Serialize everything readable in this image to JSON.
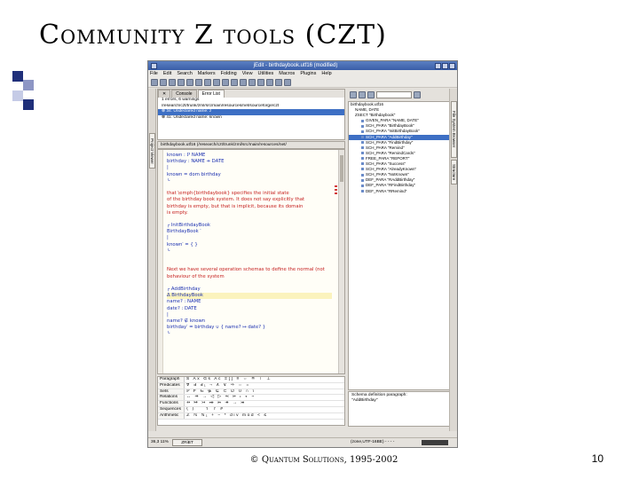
{
  "slide": {
    "title": "Community Z tools (CZT)",
    "footer": "© Quantum Solutions, 1995-2002",
    "page_number": "10",
    "bullet_colors": [
      "#1f2f7a",
      "#8d96c4",
      "#c5cbe6"
    ]
  },
  "window": {
    "title": "jEdit - birthdaybook.utf16 (modified)",
    "menu": [
      "File",
      "Edit",
      "Search",
      "Markers",
      "Folding",
      "View",
      "Utilities",
      "Macros",
      "Plugins",
      "Help"
    ]
  },
  "dock": {
    "left_tab": "Project Viewer",
    "right_tabs": [
      "File System Browser",
      "Structure"
    ]
  },
  "errors": {
    "tabs": [
      "Console",
      "Error List"
    ],
    "summary": "1 errors, 6 warnings",
    "lines": [
      "/research/czt/trunk/zml/src/main/resources/net/sourceforge/czt",
      "⊗ 34: Undeclared name: z",
      "⊗ 41: Undeclared name: known"
    ]
  },
  "buffer": {
    "name": "birthdaybook.utf16 (/research/czt/trunk/zml/src/main/resources/net/"
  },
  "editor": {
    "lines": [
      {
        "text": "known : ℙ NAME",
        "cls": "z"
      },
      {
        "text": "birthday : NAME ⇸ DATE",
        "cls": "z"
      },
      {
        "text": "|",
        "cls": "z"
      },
      {
        "text": "known = dom birthday",
        "cls": "z"
      },
      {
        "text": "└",
        "cls": "z"
      },
      {
        "text": "",
        "cls": "blank"
      },
      {
        "text": "that \\emph{birthdaybook} specifies the initial state",
        "cls": "red"
      },
      {
        "text": "of the birthday book system. It does not say explicitly that",
        "cls": "red"
      },
      {
        "text": "birthday is empty, but that is implicit, because its domain",
        "cls": "red"
      },
      {
        "text": "is empty.",
        "cls": "red"
      },
      {
        "text": "",
        "cls": "blank"
      },
      {
        "text": "┌ InitBirthdayBook",
        "cls": "z"
      },
      {
        "text": "BirthdayBook ′",
        "cls": "z"
      },
      {
        "text": "|",
        "cls": "z"
      },
      {
        "text": "known′ = { }",
        "cls": "z"
      },
      {
        "text": "└",
        "cls": "z"
      },
      {
        "text": "",
        "cls": "blank"
      },
      {
        "text": "",
        "cls": "blank"
      },
      {
        "text": "Next we have several operation schemas to define the normal (not",
        "cls": "red"
      },
      {
        "text": "behaviour of the system",
        "cls": "red"
      },
      {
        "text": "",
        "cls": "blank"
      },
      {
        "text": "┌ AddBirthday",
        "cls": "z"
      },
      {
        "text": "Δ BirthdayBook",
        "cls": "z hl"
      },
      {
        "text": "name? : NAME",
        "cls": "z"
      },
      {
        "text": "date? : DATE",
        "cls": "z"
      },
      {
        "text": "|",
        "cls": "z"
      },
      {
        "text": "name? ∉ known",
        "cls": "z"
      },
      {
        "text": "birthday′ = birthday ∪ { name? ↦ date? }",
        "cls": "z"
      },
      {
        "text": "└",
        "cls": "z"
      }
    ]
  },
  "symbols": {
    "rows": [
      {
        "head": "Paragraph",
        "cells": "S  Ax  Gs  Ac  Ξ[]  ≡  ⇔  ≙  ⊤ ⊥"
      },
      {
        "head": "Predicates",
        "cells": "∀  ∃  ∃₁  ¬  ∧  ∨  ⇒  ⇔  ="
      },
      {
        "head": "Sets",
        "cells": "ℙ  F  ∈  ∉  ⊆  ⊂  ∅  ∪  ∩  \\"
      },
      {
        "head": "Relations",
        "cells": "↔  ⇸  →  ◁  ▷  ⩤  ⩥  ⨾  ∘  ~"
      },
      {
        "head": "Functions",
        "cells": "⇸  ↦  ↣  ⤀  ⤔  ↠  →  ⤖"
      },
      {
        "head": "Sequences",
        "cells": "⟨  ⟩  ⁀  ↿  ↾  #"
      },
      {
        "head": "Arithmetic",
        "cells": "ℤ  ℕ  ℕ₁  +  −  *  div  mod  <  ≤"
      }
    ]
  },
  "structure": {
    "nodes": [
      {
        "text": "birthdaybook.utf16",
        "depth": 0
      },
      {
        "text": "NAME, DATE",
        "depth": 1
      },
      {
        "text": "ZSECT \"Birthdaybook\"",
        "depth": 1
      },
      {
        "text": "GIVEN_PARA \"NAME, DATE\"",
        "depth": 2
      },
      {
        "text": "SCH_PARA \"BirthdayBook\"",
        "depth": 2
      },
      {
        "text": "SCH_PARA \"InitBirthdayBook\"",
        "depth": 2
      },
      {
        "text": "SCH_PARA \"AddBirthday\"",
        "depth": 2,
        "selected": true
      },
      {
        "text": "SCH_PARA \"FindBirthday\"",
        "depth": 2
      },
      {
        "text": "SCH_PARA \"Remind\"",
        "depth": 2
      },
      {
        "text": "SCH_PARA \"RemindCards\"",
        "depth": 2
      },
      {
        "text": "FREE_PARA \"REPORT\"",
        "depth": 2
      },
      {
        "text": "SCH_PARA \"Success\"",
        "depth": 2
      },
      {
        "text": "SCH_PARA \"AlreadyKnown\"",
        "depth": 2
      },
      {
        "text": "SCH_PARA \"NotKnown\"",
        "depth": 2
      },
      {
        "text": "DEF_PARA \"RAddBirthday\"",
        "depth": 2
      },
      {
        "text": "DEF_PARA \"RFindBirthday\"",
        "depth": 2
      },
      {
        "text": "DEF_PARA \"RRemind\"",
        "depth": 2
      }
    ],
    "hint": [
      "Schema definition paragraph:",
      "\"AddBirthday\""
    ]
  },
  "status": {
    "position": "36,3  11%",
    "button": "ZRiBT",
    "info": "(zone,UTF-16BE) - - - -"
  }
}
